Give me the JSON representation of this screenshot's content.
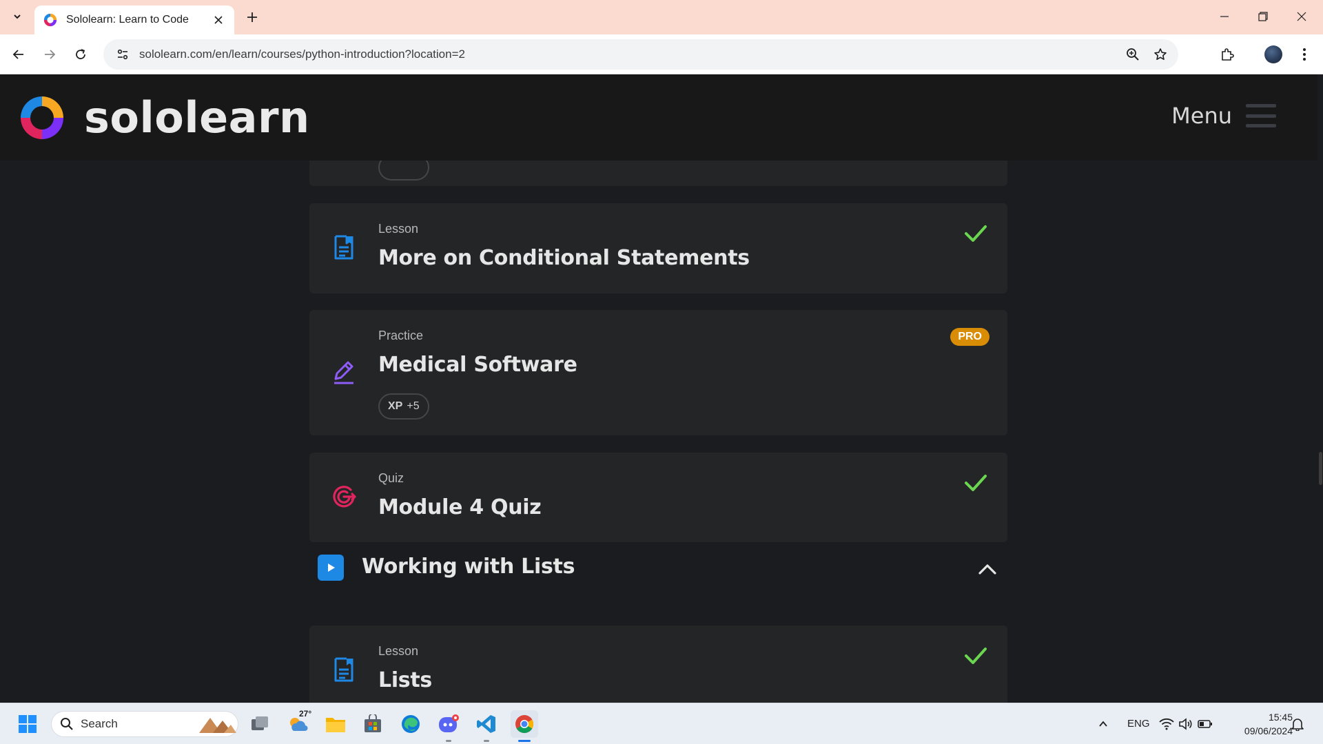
{
  "browser": {
    "tab_title": "Sololearn: Learn to Code",
    "url": "sololearn.com/en/learn/courses/python-introduction?location=2"
  },
  "site": {
    "brand": "sololearn",
    "menu_label": "Menu"
  },
  "items": [
    {
      "type": "Lesson",
      "title": "More on Conditional Statements",
      "icon": "lesson-icon",
      "completed": true
    },
    {
      "type": "Practice",
      "title": "Medical Software",
      "icon": "practice-pencil-icon",
      "badge": "PRO",
      "xp_label": "XP",
      "xp_value": "+5"
    },
    {
      "type": "Quiz",
      "title": "Module 4 Quiz",
      "icon": "quiz-target-icon",
      "completed": true
    }
  ],
  "module": {
    "title": "Working with Lists",
    "expanded": true
  },
  "module_items": [
    {
      "type": "Lesson",
      "title": "Lists",
      "icon": "lesson-icon",
      "completed": true
    }
  ],
  "taskbar": {
    "search_placeholder": "Search",
    "weather_temp": "27°",
    "language": "ENG",
    "time": "15:45",
    "date": "09/06/2024"
  },
  "colors": {
    "page_bg": "#1b1c1f",
    "card_bg": "#242527",
    "check_green": "#6bd64f",
    "pro_badge": "#d98d06",
    "lesson_icon": "#1e88e5",
    "practice_icon": "#8e5cf7",
    "quiz_icon": "#e0245e",
    "tabbar_bg": "#fbdad0"
  }
}
